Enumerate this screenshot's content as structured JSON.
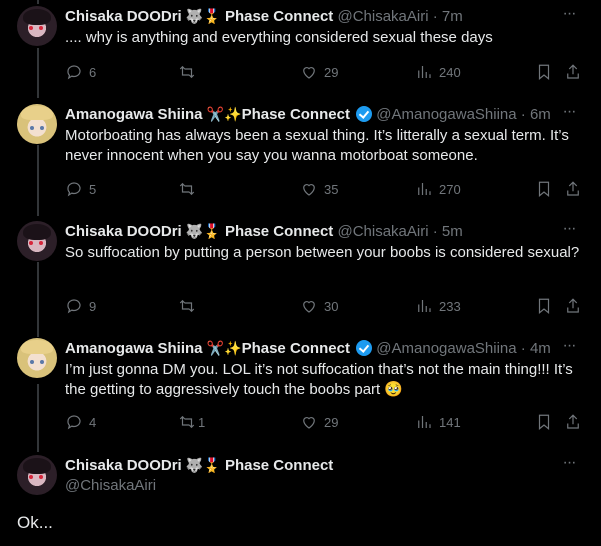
{
  "tweets": [
    {
      "name": "Chisaka DOODri",
      "badges": "🐺🎖️",
      "affiliation": "Phase Connect",
      "handle": "@ChisakaAiri",
      "time": "7m",
      "text": ".... why is anything and everything considered sexual these days",
      "replies": "6",
      "likes": "29",
      "views": "240"
    },
    {
      "name": "Amanogawa Shiina",
      "badges": "✂️✨",
      "affiliation": "Phase Connect",
      "handle": "@AmanogawaShiina",
      "time": "6m",
      "text": "Motorboating has always been a sexual thing. It’s litterally a sexual term. It’s never innocent when you say you wanna motorboat someone.",
      "replies": "5",
      "likes": "35",
      "views": "270"
    },
    {
      "name": "Chisaka DOODri",
      "badges": "🐺🎖️",
      "affiliation": "Phase Connect",
      "handle": "@ChisakaAiri",
      "time": "5m",
      "text": "So suffocation by putting a person between your boobs is considered sexual?",
      "replies": "9",
      "likes": "30",
      "views": "233"
    },
    {
      "name": "Amanogawa Shiina",
      "badges": "✂️✨",
      "affiliation": "Phase Connect",
      "handle": "@AmanogawaShiina",
      "time": "4m",
      "text": "I’m just gonna DM you. LOL it’s not suffocation that’s not the main thing!!! It’s the getting to aggressively touch the boobs part 🥹",
      "replies": "4",
      "retweets": "1",
      "likes": "29",
      "views": "141"
    }
  ],
  "main_tweet": {
    "name": "Chisaka DOODri",
    "badges": "🐺🎖️",
    "affiliation": "Phase Connect",
    "handle": "@ChisakaAiri",
    "text": "Ok..."
  },
  "separator": "·",
  "icons": {
    "reply": "reply-icon",
    "retweet": "retweet-icon",
    "like": "like-icon",
    "views": "views-icon",
    "bookmark": "bookmark-icon",
    "share": "share-icon",
    "more": "more-icon"
  },
  "colors": {
    "background": "#000000",
    "text": "#e7e9ea",
    "muted": "#71767b",
    "verified": "#1d9bf0",
    "thread_line": "#333639"
  }
}
